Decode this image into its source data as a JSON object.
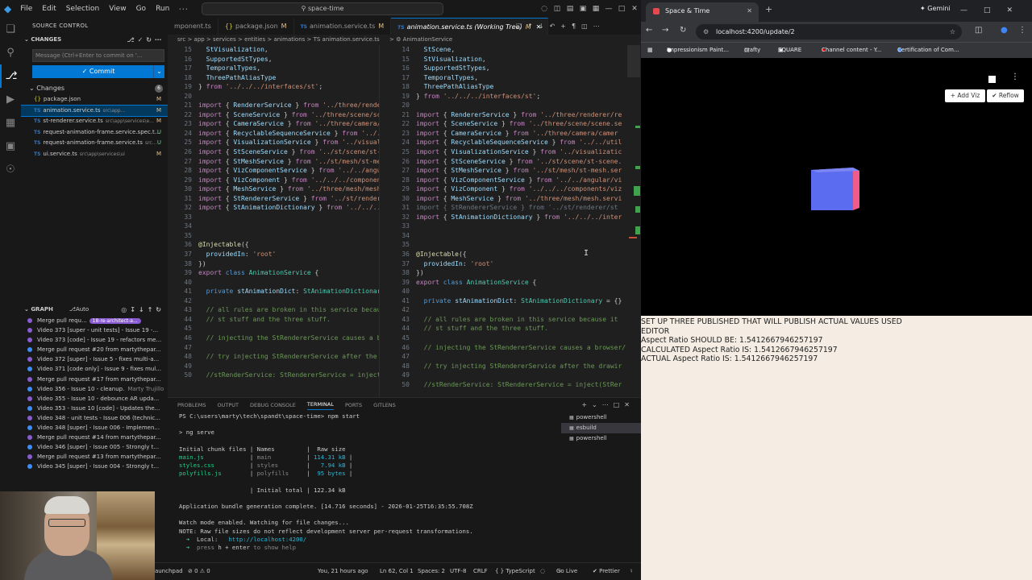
{
  "vscode": {
    "menu": [
      "File",
      "Edit",
      "Selection",
      "View",
      "Go",
      "Run"
    ],
    "command_center": "space-time",
    "sidebar": {
      "title": "SOURCE CONTROL",
      "changes_header": "CHANGES",
      "commit_placeholder": "Message (Ctrl+Enter to commit on '...",
      "commit_label": "Commit",
      "changes_label": "Changes",
      "changes_count": "6",
      "files": [
        {
          "name": "package.json",
          "dir": "",
          "status": "M",
          "kind": "json"
        },
        {
          "name": "animation.service.ts",
          "dir": "src\\app...",
          "status": "M",
          "kind": "ts"
        },
        {
          "name": "st-renderer.service.ts",
          "dir": "src\\app\\services\\e...",
          "status": "M",
          "kind": "ts"
        },
        {
          "name": "request-animation-frame.service.spec.t...",
          "dir": "",
          "status": "U",
          "kind": "ts"
        },
        {
          "name": "request-animation-frame.service.ts",
          "dir": "src...",
          "status": "U",
          "kind": "ts"
        },
        {
          "name": "ui.service.ts",
          "dir": "src\\app\\services\\ui",
          "status": "M",
          "kind": "ts"
        }
      ],
      "graph_header": "GRAPH",
      "graph_auto": "Auto",
      "graph": [
        {
          "text": "Merge pull requ...",
          "badge": "18-re-architect-a...",
          "author": "",
          "color": "#8a5cd1"
        },
        {
          "text": "Video 373 [super - unit tests] - Issue 19 -...",
          "badge": "",
          "author": "",
          "color": "#8a5cd1"
        },
        {
          "text": "Video 373 [code] - Issue 19 - refactors me...",
          "badge": "",
          "author": "",
          "color": "#8a5cd1"
        },
        {
          "text": "Merge pull request #20 from martythepar...",
          "badge": "",
          "author": "",
          "color": "#3d8df5"
        },
        {
          "text": "Video 372 [super] - Issue 5 - fixes multi-a...",
          "badge": "",
          "author": "",
          "color": "#8a5cd1"
        },
        {
          "text": "Video 371 [code only] - Issue 9 - fixes mul...",
          "badge": "",
          "author": "",
          "color": "#3d8df5"
        },
        {
          "text": "Merge pull request #17 from martythepar...",
          "badge": "",
          "author": "",
          "color": "#8a5cd1"
        },
        {
          "text": "Video 356 - Issue 10 - cleanup.",
          "badge": "",
          "author": "Marty Trujillo",
          "color": "#3d8df5"
        },
        {
          "text": "Video 355 - Issue 10 - debounce AR upda...",
          "badge": "",
          "author": "",
          "color": "#8a5cd1"
        },
        {
          "text": "Video 353 - Issue 10 [code] - Updates the...",
          "badge": "",
          "author": "",
          "color": "#3d8df5"
        },
        {
          "text": "Video 348 - unit tests - Issue 006 (technic...",
          "badge": "",
          "author": "",
          "color": "#8a5cd1"
        },
        {
          "text": "Video 348 [super] - Issue 006 - Implemen...",
          "badge": "",
          "author": "",
          "color": "#3d8df5"
        },
        {
          "text": "Merge pull request #14 from martythepar...",
          "badge": "",
          "author": "",
          "color": "#8a5cd1"
        },
        {
          "text": "Video 346 [super] - Issue 005 - Strongly t...",
          "badge": "",
          "author": "",
          "color": "#3d8df5"
        },
        {
          "text": "Merge pull request #13 from martythepar...",
          "badge": "",
          "author": "",
          "color": "#8a5cd1"
        },
        {
          "text": "Video 345 [super] - Issue 004 - Strongly t...",
          "badge": "",
          "author": "",
          "color": "#3d8df5"
        }
      ]
    },
    "tabs": [
      {
        "label": "mponent.ts",
        "kind": "",
        "mod": "",
        "active": false
      },
      {
        "label": "package.json",
        "kind": "json",
        "mod": "M",
        "active": false
      },
      {
        "label": "animation.service.ts",
        "kind": "ts",
        "mod": "M",
        "active": false
      },
      {
        "label": "animation.service.ts (Working Tree)",
        "kind": "ts",
        "mod": "M",
        "active": true
      }
    ],
    "breadcrumb_left": "src > app > services > entities > animations > TS animation.service.ts",
    "breadcrumb_right": "> ⚙ AnimationService",
    "code_left": [
      {
        "n": "15",
        "h": "  <span class='vr'>StVisualization</span>,"
      },
      {
        "n": "16",
        "h": "  <span class='vr'>SupportedStTypes</span>,"
      },
      {
        "n": "17",
        "h": "  <span class='vr'>TemporalTypes</span>,"
      },
      {
        "n": "18",
        "h": "  <span class='vr'>ThreePathAliasType</span>"
      },
      {
        "n": "19",
        "h": "} <span class='kw'>from</span> <span class='str'>'../../../interfaces/st'</span>;"
      },
      {
        "n": "20",
        "h": ""
      },
      {
        "n": "21",
        "h": "<span class='kw'>import</span> { <span class='vr'>RendererService</span> } <span class='kw'>from</span> <span class='str'>'../three/render</span>"
      },
      {
        "n": "22",
        "h": "<span class='kw'>import</span> { <span class='vr'>SceneService</span> } <span class='kw'>from</span> <span class='str'>'../three/scene/sce</span>"
      },
      {
        "n": "23",
        "h": "<span class='kw'>import</span> { <span class='vr'>CameraService</span> } <span class='kw'>from</span> <span class='str'>'../three/camera/c</span>"
      },
      {
        "n": "24",
        "h": "<span class='kw'>import</span> { <span class='vr'>RecyclableSequenceService</span> } <span class='kw'>from</span> <span class='str'>'../.</span>"
      },
      {
        "n": "25",
        "h": "<span class='kw'>import</span> { <span class='vr'>VisualizationService</span> } <span class='kw'>from</span> <span class='str'>'../visuali</span>"
      },
      {
        "n": "26",
        "h": "<span class='kw'>import</span> { <span class='vr'>StSceneService</span> } <span class='kw'>from</span> <span class='str'>'../st/scene/st-s</span>"
      },
      {
        "n": "27",
        "h": "<span class='kw'>import</span> { <span class='vr'>StMeshService</span> } <span class='kw'>from</span> <span class='str'>'../st/mesh/st-mes</span>"
      },
      {
        "n": "28",
        "h": "<span class='kw'>import</span> { <span class='vr'>VizComponentService</span> } <span class='kw'>from</span> <span class='str'>'../../angul</span>"
      },
      {
        "n": "29",
        "h": "<span class='kw'>import</span> { <span class='vr'>VizComponent</span> } <span class='kw'>from</span> <span class='str'>'../../../component</span>"
      },
      {
        "n": "30",
        "h": "<span class='kw'>import</span> { <span class='vr'>MeshService</span> } <span class='kw'>from</span> <span class='str'>'../three/mesh/mesh.</span>"
      },
      {
        "n": "31",
        "h": "<span class='kw'>import</span> { <span class='vr'>StRendererService</span> } <span class='kw'>from</span> <span class='str'>'../st/rendere</span>"
      },
      {
        "n": "32",
        "h": "<span class='kw'>import</span> { <span class='vr'>StAnimationDictionary</span> } <span class='kw'>from</span> <span class='str'>'../../../inte</span>"
      },
      {
        "n": "",
        "h": ""
      },
      {
        "n": "",
        "h": ""
      },
      {
        "n": "",
        "h": ""
      },
      {
        "n": "",
        "h": "<span class='dec'>@Injectable</span>({"
      },
      {
        "n": "",
        "h": "  <span class='vr'>providedIn</span>: <span class='str'>'root'</span>"
      },
      {
        "n": "",
        "h": "})"
      },
      {
        "n": "",
        "h": "<span class='kw'>export</span> <span class='kb'>class</span> <span class='ty'>AnimationService</span> {"
      },
      {
        "n": "",
        "h": ""
      },
      {
        "n": "",
        "h": "  <span class='kb'>private</span> <span class='vr'>stAnimationDict</span>: <span class='ty'>StAnimationDictionary</span>"
      },
      {
        "n": "",
        "h": ""
      },
      {
        "n": "",
        "h": "  <span class='cm'>// all rules are broken in this service becaus</span>"
      },
      {
        "n": "",
        "h": "  <span class='cm'>// st stuff and the three stuff.</span>"
      },
      {
        "n": "",
        "h": ""
      },
      {
        "n": "",
        "h": "  <span class='cm'>// injecting the StRendererService causes a bro</span>"
      },
      {
        "n": "",
        "h": ""
      },
      {
        "n": "",
        "h": "  <span class='cm'>// try injecting StRendererService after the d</span>"
      },
      {
        "n": "",
        "h": ""
      },
      {
        "n": "",
        "h": "  <span class='cm'>//stRenderService: StRendererService = inject(</span>"
      }
    ],
    "code_right": [
      {
        "n": "14",
        "h": "  <span class='vr'>StScene</span>,"
      },
      {
        "n": "15",
        "h": "  <span class='vr'>StVisualization</span>,"
      },
      {
        "n": "16",
        "h": "  <span class='vr'>SupportedStTypes</span>,"
      },
      {
        "n": "17",
        "h": "  <span class='vr'>TemporalTypes</span>,"
      },
      {
        "n": "18",
        "h": "  <span class='vr'>ThreePathAliasType</span>"
      },
      {
        "n": "19",
        "h": "} <span class='kw'>from</span> <span class='str'>'../../../interfaces/st'</span>;"
      },
      {
        "n": "20",
        "h": ""
      },
      {
        "n": "21",
        "h": "<span class='kw'>import</span> { <span class='vr'>RendererService</span> } <span class='kw'>from</span> <span class='str'>'../three/renderer/re</span>"
      },
      {
        "n": "22",
        "h": "<span class='kw'>import</span> { <span class='vr'>SceneService</span> } <span class='kw'>from</span> <span class='str'>'../three/scene/scene.se</span>"
      },
      {
        "n": "23",
        "h": "<span class='kw'>import</span> { <span class='vr'>CameraService</span> } <span class='kw'>from</span> <span class='str'>'../three/camera/camer</span>"
      },
      {
        "n": "24",
        "h": "<span class='kw'>import</span> { <span class='vr'>RecyclableSequenceService</span> } <span class='kw'>from</span> <span class='str'>'../../util</span>"
      },
      {
        "n": "25",
        "h": "<span class='kw'>import</span> { <span class='vr'>VisualizationService</span> } <span class='kw'>from</span> <span class='str'>'../visualizatic</span>"
      },
      {
        "n": "26",
        "h": "<span class='kw'>import</span> { <span class='vr'>StSceneService</span> } <span class='kw'>from</span> <span class='str'>'../st/scene/st-scene.</span>"
      },
      {
        "n": "27",
        "h": "<span class='kw'>import</span> { <span class='vr'>StMeshService</span> } <span class='kw'>from</span> <span class='str'>'../st/mesh/st-mesh.ser</span>"
      },
      {
        "n": "28",
        "h": "<span class='kw'>import</span> { <span class='vr'>VizComponentService</span> } <span class='kw'>from</span> <span class='str'>'../../angular/vi</span>"
      },
      {
        "n": "29",
        "h": "<span class='kw'>import</span> { <span class='vr'>VizComponent</span> } <span class='kw'>from</span> <span class='str'>'../../../components/viz</span>"
      },
      {
        "n": "30",
        "h": "<span class='kw'>import</span> { <span class='vr'>MeshService</span> } <span class='kw'>from</span> <span class='str'>'../three/mesh/mesh.servi</span>"
      },
      {
        "n": "31",
        "h": "<span class='cm' style='color:#6e7681'>import { StRendererService } from '../st/renderer/st</span>"
      },
      {
        "n": "32",
        "h": "<span class='kw'>import</span> { <span class='vr'>StAnimationDictionary</span> } <span class='kw'>from</span> <span class='str'>'../../../inter</span>"
      },
      {
        "n": "33",
        "h": ""
      },
      {
        "n": "34",
        "h": ""
      },
      {
        "n": "35",
        "h": ""
      },
      {
        "n": "36",
        "h": "<span class='dec'>@Injectable</span>({"
      },
      {
        "n": "37",
        "h": "  <span class='vr'>providedIn</span>: <span class='str'>'root'</span>"
      },
      {
        "n": "38",
        "h": "})"
      },
      {
        "n": "39",
        "h": "<span class='kw'>export</span> <span class='kb'>class</span> <span class='ty'>AnimationService</span> {"
      },
      {
        "n": "40",
        "h": ""
      },
      {
        "n": "41",
        "h": "  <span class='kb'>private</span> <span class='vr'>stAnimationDict</span>: <span class='ty'>StAnimationDictionary</span> = {}"
      },
      {
        "n": "42",
        "h": ""
      },
      {
        "n": "43",
        "h": "  <span class='cm'>// all rules are broken in this service because it</span>"
      },
      {
        "n": "44",
        "h": "  <span class='cm'>// st stuff and the three stuff.</span>"
      },
      {
        "n": "45",
        "h": ""
      },
      {
        "n": "46",
        "h": "  <span class='cm'>// injecting the StRendererService causes a browser/</span>"
      },
      {
        "n": "47",
        "h": ""
      },
      {
        "n": "48",
        "h": "  <span class='cm'>// try injecting StRendererService after the drawir</span>"
      },
      {
        "n": "49",
        "h": ""
      },
      {
        "n": "50",
        "h": "  <span class='cm'>//stRenderService: StRendererService = inject(StRer</span>"
      }
    ],
    "panel_tabs": [
      "PROBLEMS",
      "OUTPUT",
      "DEBUG CONSOLE",
      "TERMINAL",
      "PORTS",
      "GITLENS"
    ],
    "terminal": [
      {
        "h": "PS C:\\users\\marty\\tech\\spandt\\space-time&gt; npm start"
      },
      {
        "h": ""
      },
      {
        "h": "&gt; ng serve"
      },
      {
        "h": ""
      },
      {
        "h": "Initial chunk files | Names         |  Raw size"
      },
      {
        "h": "<span class='tg'>main.js</span>             | <span class='tgr'>main</span>          | <span class='tc'>114.31 kB</span> |"
      },
      {
        "h": "<span class='tg'>styles.css</span>          | <span class='tgr'>styles</span>        | <span class='tc'>  7.94 kB</span> |"
      },
      {
        "h": "<span class='tg'>polyfills.js</span>        | <span class='tgr'>polyfills</span>     | <span class='tc'> 95 bytes</span> |"
      },
      {
        "h": ""
      },
      {
        "h": "                    | Initial total | 122.34 kB"
      },
      {
        "h": ""
      },
      {
        "h": "Application bundle generation complete. [14.716 seconds] - 2026-01-25T16:35:55.708Z"
      },
      {
        "h": ""
      },
      {
        "h": "Watch mode enabled. Watching for file changes..."
      },
      {
        "h": "NOTE: Raw file sizes do not reflect development server per-request transformations."
      },
      {
        "h": "  <span class='tg'>➜</span>  Local:   <span class='tc'>http://localhost:4200/</span>"
      },
      {
        "h": "  <span class='tg'>➜</span>  <span class='tgr'>press</span> h + enter <span class='tgr'>to show help</span>"
      }
    ],
    "terminal_list": [
      "powershell",
      "esbuild",
      "powershell"
    ],
    "status": {
      "launchpad": "launchpad",
      "errors": "⊘ 0 ⚠ 0",
      "blame": "You, 21 hours ago",
      "cursor": "Ln 62, Col 1",
      "spaces": "Spaces: 2",
      "encoding": "UTF-8",
      "eol": "CRLF",
      "lang": "{ } TypeScript",
      "golive": "Go Live",
      "prettier": "✔ Prettier"
    }
  },
  "browser": {
    "tab_title": "Space & Time",
    "gemini": "Gemini",
    "url": "localhost:4200/update/2",
    "bookmarks": [
      "Impressionism Paint...",
      "crafty",
      "SQUARE",
      "Channel content - Y...",
      "Certification of Com..."
    ],
    "add_viz": "+ Add Viz",
    "reflow": "✔ Reflow",
    "info": [
      "SET UP THREE PUBLISHED THAT WILL PUBLISH ACTUAL VALUES USED",
      "EDITOR",
      "Aspect Ratio SHOULD BE: 1.5412667946257197",
      "CALCULATED Aspect Ratio IS: 1.5412667946257197",
      "ACTUAL Aspect Ratio IS: 1.5412667946257197"
    ]
  },
  "colors": {
    "accent": "#0078d4",
    "editor_bg": "#1f1f1f",
    "info_bg": "#f5ede3"
  }
}
